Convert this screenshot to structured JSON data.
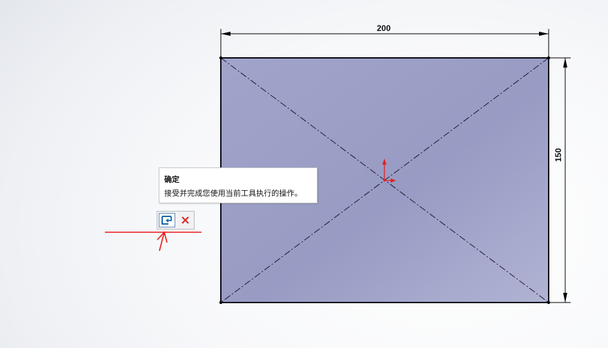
{
  "sketch": {
    "width_dimension": "200",
    "height_dimension": "150"
  },
  "tooltip": {
    "title": "确定",
    "description": "接受并完成您使用当前工具执行的操作。"
  },
  "confirm_corner": {
    "ok_icon": "ok-check-icon",
    "cancel_icon": "close-icon"
  },
  "colors": {
    "rectangle_fill": "#9fa2c8",
    "construction_line": "#1a1a2e",
    "origin_arrows": "#e32020",
    "cancel_x": "#d0312d",
    "annotation_red": "#e81a1a"
  }
}
